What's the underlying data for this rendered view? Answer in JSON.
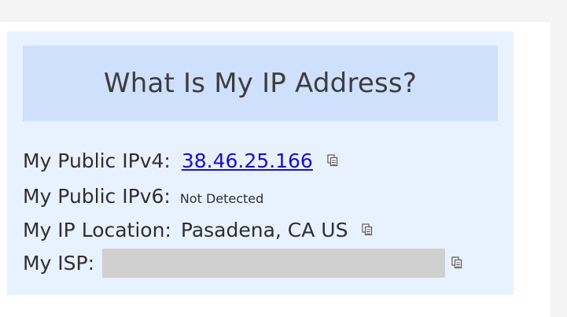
{
  "card": {
    "title": "What Is My IP Address?"
  },
  "rows": {
    "ipv4": {
      "label": "My Public IPv4:",
      "value": "38.46.25.166"
    },
    "ipv6": {
      "label": "My Public IPv6:",
      "value": "Not Detected"
    },
    "location": {
      "label": "My IP Location:",
      "value": "Pasadena, CA US"
    },
    "isp": {
      "label": "My ISP:",
      "value": ""
    }
  },
  "icons": {
    "copy": "copy-icon"
  },
  "colors": {
    "card_background": "#e8f1fe",
    "title_banner": "#cfe0fc",
    "link": "#1a0dd0",
    "redaction": "#d0d0d0"
  }
}
